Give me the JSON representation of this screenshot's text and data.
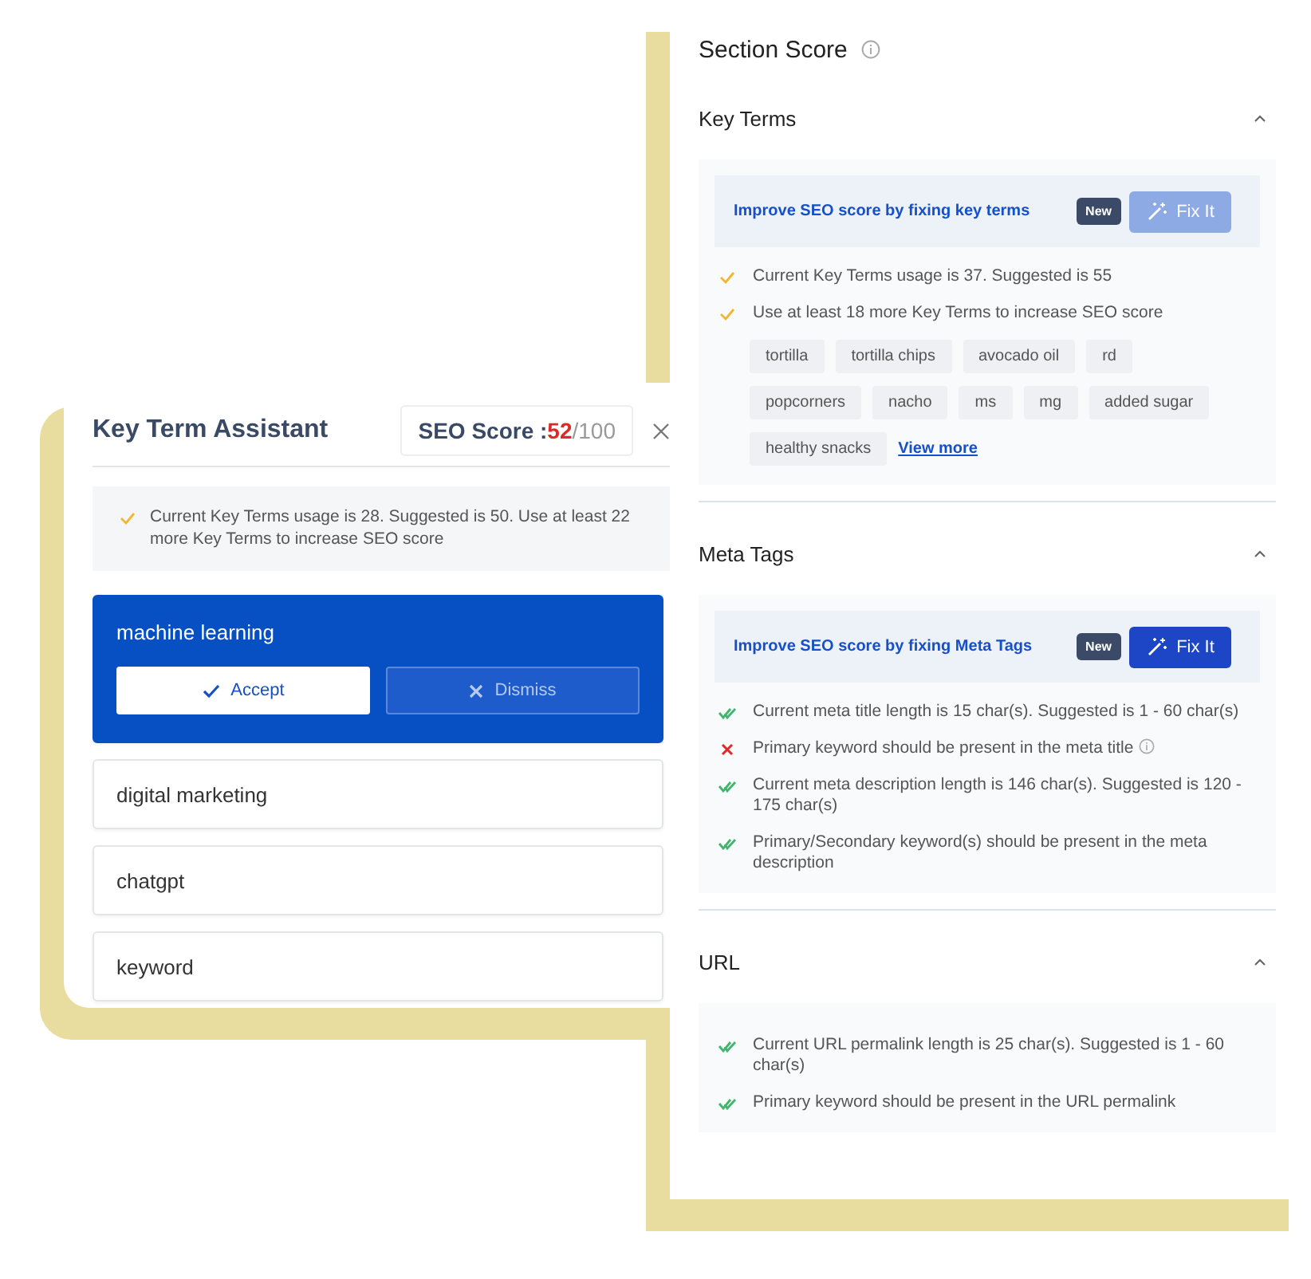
{
  "key_term_assistant": {
    "title": "Key Term Assistant",
    "seo_score": {
      "label": "SEO Score :",
      "value": "52",
      "max": "/100"
    },
    "message": {
      "kind": "warning",
      "text": "Current Key Terms usage is 28. Suggested is 50. Use at least 22 more Key Terms to increase SEO score"
    },
    "terms": [
      {
        "label": "machine learning",
        "expanded": true,
        "actions": [
          {
            "kind": "accept",
            "label": "Accept"
          },
          {
            "kind": "dismiss",
            "label": "Dismiss"
          }
        ]
      },
      {
        "label": "digital marketing",
        "expanded": false
      },
      {
        "label": "chatgpt",
        "expanded": false
      },
      {
        "label": "keyword",
        "expanded": false
      }
    ]
  },
  "section_score": {
    "title": "Section Score",
    "sections": [
      {
        "title": "Key Terms",
        "expanded": true,
        "banner": {
          "text": "Improve SEO score by fixing key terms",
          "badge": "New",
          "button": {
            "label": "Fix It",
            "disabled": true
          }
        },
        "checks": [
          {
            "kind": "warning",
            "text": "Current Key Terms usage is 37. Suggested is 55",
            "info": false
          },
          {
            "kind": "warning",
            "text": "Use at least 18 more Key Terms to increase SEO score",
            "info": false
          }
        ],
        "tags": [
          "tortilla",
          "tortilla chips",
          "avocado oil",
          "rd",
          "popcorners",
          "nacho",
          "ms",
          "mg",
          "added sugar",
          "healthy snacks"
        ],
        "link": "View more"
      },
      {
        "title": "Meta Tags",
        "expanded": true,
        "banner": {
          "text": "Improve SEO score by fixing Meta Tags",
          "badge": "New",
          "button": {
            "label": "Fix It",
            "disabled": false
          }
        },
        "checks": [
          {
            "kind": "pass",
            "text": "Current meta title length is 15 char(s). Suggested is 1 - 60 char(s)",
            "info": false
          },
          {
            "kind": "fail",
            "text": "Primary keyword should be present in the meta title",
            "info": true
          },
          {
            "kind": "pass",
            "text": "Current meta description length is 146 char(s). Suggested is 120 - 175 char(s)",
            "info": false
          },
          {
            "kind": "pass",
            "text": "Primary/Secondary keyword(s) should be present in the meta description",
            "info": false
          }
        ]
      },
      {
        "title": "URL",
        "expanded": true,
        "checks": [
          {
            "kind": "pass",
            "text": "Current URL permalink length is 25 char(s). Suggested is 1 - 60 char(s)",
            "info": false
          },
          {
            "kind": "pass",
            "text": "Primary keyword should be present in the URL permalink",
            "info": false
          }
        ]
      }
    ]
  }
}
